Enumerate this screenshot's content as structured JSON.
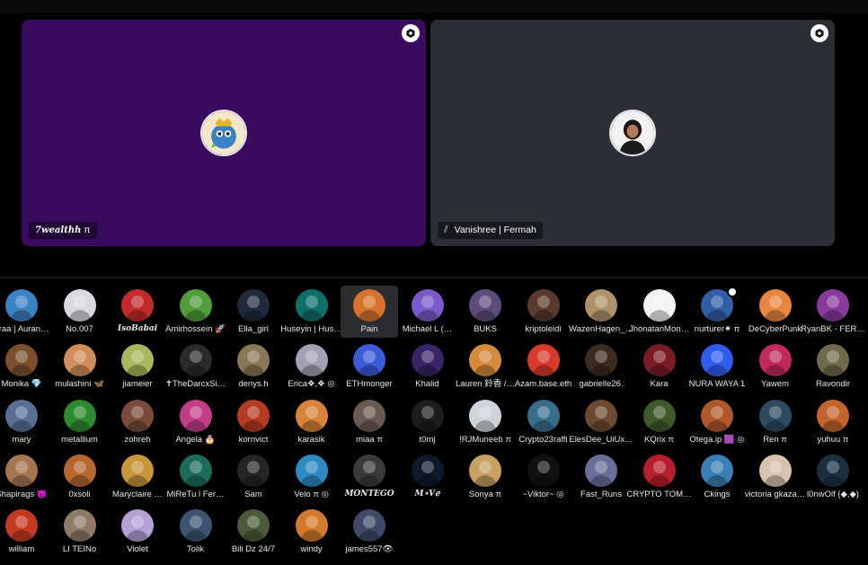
{
  "top_tiles": [
    {
      "name": "7wealthh",
      "suffix": "π",
      "bg": "#3a0a5e"
    },
    {
      "name": "Vanishree | Fermah",
      "prefix": "⫽",
      "bg": "#2c2e35"
    }
  ],
  "participants": [
    {
      "name": "uraa | Auran…",
      "color": "#3b82c4"
    },
    {
      "name": "No.007",
      "color": "#d9d9df"
    },
    {
      "name": "IsoBabai",
      "color": "#c42a2a",
      "stylized": true
    },
    {
      "name": "Amirhossein 🚀",
      "color": "#4f9d3b"
    },
    {
      "name": "Ella_girl",
      "color": "#1f2a3d"
    },
    {
      "name": "Huseyin | Hus…",
      "color": "#0e6e6a"
    },
    {
      "name": "Pain",
      "color": "#d8732d",
      "selected": true
    },
    {
      "name": "Michael L (…",
      "color": "#7a59c9"
    },
    {
      "name": "BUKS",
      "color": "#5c4d7a"
    },
    {
      "name": "kriptoleidi",
      "color": "#5a3a2e"
    },
    {
      "name": "WazenHagen_…",
      "color": "#b0926a"
    },
    {
      "name": "JhonatanMon…",
      "color": "#f3f3f3"
    },
    {
      "name": "nurturer✷ π",
      "color": "#2f5fa6",
      "status": true
    },
    {
      "name": "DeCyberPunk",
      "color": "#e7873d"
    },
    {
      "name": "RyanBK - FER…",
      "color": "#8a3a9c"
    },
    {
      "name": "Monika 💎",
      "color": "#7b4f2e"
    },
    {
      "name": "mulashini 🦋",
      "color": "#d28e5a"
    },
    {
      "name": "jiameier",
      "color": "#a9b85c"
    },
    {
      "name": "✝TheDarcxSi…",
      "color": "#2a2a2a"
    },
    {
      "name": "denys.h",
      "color": "#8a7756"
    },
    {
      "name": "Erica❖,❖ ◎",
      "color": "#a6a0b4"
    },
    {
      "name": "ETHmonger",
      "color": "#3b5bd9"
    },
    {
      "name": "Khalid",
      "color": "#3a2366"
    },
    {
      "name": "Lauren 鈴香 /…",
      "color": "#d68a3c"
    },
    {
      "name": "Azam.base.eth",
      "color": "#d93a2b"
    },
    {
      "name": "gabrielle26.",
      "color": "#3d2a1e"
    },
    {
      "name": "Kara",
      "color": "#7a1c24"
    },
    {
      "name": "NURA WAYA 1",
      "color": "#2e5df0"
    },
    {
      "name": "Yawem",
      "color": "#c22a5c"
    },
    {
      "name": "Ravondir",
      "color": "#6f6a4a"
    },
    {
      "name": "mary",
      "color": "#5a6f96"
    },
    {
      "name": "metallium",
      "color": "#2e8a2e"
    },
    {
      "name": "zohreh",
      "color": "#7a4a3a"
    },
    {
      "name": "Angela 🎂",
      "color": "#c23d86"
    },
    {
      "name": "kornvict",
      "color": "#b53b22"
    },
    {
      "name": "karasik",
      "color": "#d9833a"
    },
    {
      "name": "miaa π",
      "color": "#6a5a52"
    },
    {
      "name": "t0mj",
      "color": "#1d1d1d"
    },
    {
      "name": "!RJMuneeb π",
      "color": "#cfd4dc"
    },
    {
      "name": "Crypto23raffi",
      "color": "#3a6d8c"
    },
    {
      "name": "ElesDee_UiUx…",
      "color": "#6b4a30"
    },
    {
      "name": "KQrix π",
      "color": "#3f5a2a"
    },
    {
      "name": "Otega.ip 🟪 ◎",
      "color": "#b0582a"
    },
    {
      "name": "Ren π",
      "color": "#2d4a5f"
    },
    {
      "name": "yuhuu π",
      "color": "#c2642c"
    },
    {
      "name": "Shapirags 👿",
      "color": "#a4764f"
    },
    {
      "name": "0xsoli",
      "color": "#b5672d"
    },
    {
      "name": "Maryclaire …",
      "color": "#c7953a"
    },
    {
      "name": "MiReTu l Fer…",
      "color": "#1c6b5c"
    },
    {
      "name": "Sam",
      "color": "#252525"
    },
    {
      "name": "Velo π ◎",
      "color": "#2f8ac2"
    },
    {
      "name": "MONTEGO",
      "color": "#3a3a3a",
      "stylized": true
    },
    {
      "name": "M⋆V𝑒",
      "color": "#0e1a2c",
      "stylized": true
    },
    {
      "name": "Sonya π",
      "color": "#c7a062"
    },
    {
      "name": "~Viktor~ ◎",
      "color": "#111111"
    },
    {
      "name": "Fast_Runs",
      "color": "#6a6f9a"
    },
    {
      "name": "CRYPTO TOM…",
      "color": "#b81f2c"
    },
    {
      "name": "Ckings",
      "color": "#3a7fb5"
    },
    {
      "name": "victoria gkaza…",
      "color": "#d8c3ad"
    },
    {
      "name": "l0nwOlf (◆,◆)",
      "color": "#1a3040"
    },
    {
      "name": "william",
      "color": "#c23a22"
    },
    {
      "name": "LI TEINo",
      "color": "#8f7b68"
    },
    {
      "name": "Violet",
      "color": "#b7a0d6"
    },
    {
      "name": "Tolik",
      "color": "#3d5470"
    },
    {
      "name": "Bili Dz 24/7",
      "color": "#4a5a3a"
    },
    {
      "name": "windy",
      "color": "#d27a2a"
    },
    {
      "name": "james557👁",
      "color": "#3e4a66"
    }
  ]
}
